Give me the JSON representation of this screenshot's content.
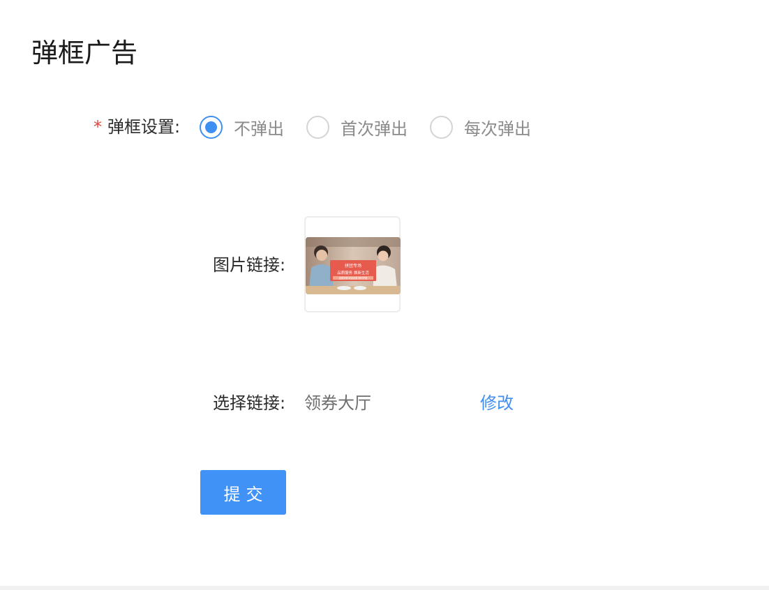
{
  "page": {
    "title": "弹框广告"
  },
  "form": {
    "popup_setting": {
      "required_mark": "*",
      "label": "弹框设置:",
      "options": [
        {
          "label": "不弹出",
          "checked": true
        },
        {
          "label": "首次弹出",
          "checked": false
        },
        {
          "label": "每次弹出",
          "checked": false
        }
      ]
    },
    "image_link": {
      "label": "图片链接:",
      "image_text": {
        "banner": "拼团专场",
        "headline": "品质服务 焕新生活",
        "subline": "品质好物 精选优惠 限时开团"
      }
    },
    "select_link": {
      "label": "选择链接:",
      "value": "领券大厅",
      "modify_label": "修改"
    },
    "submit_label": "提交"
  },
  "colors": {
    "primary": "#4092f6",
    "required": "#e0443c",
    "link": "#3f8ef2"
  }
}
